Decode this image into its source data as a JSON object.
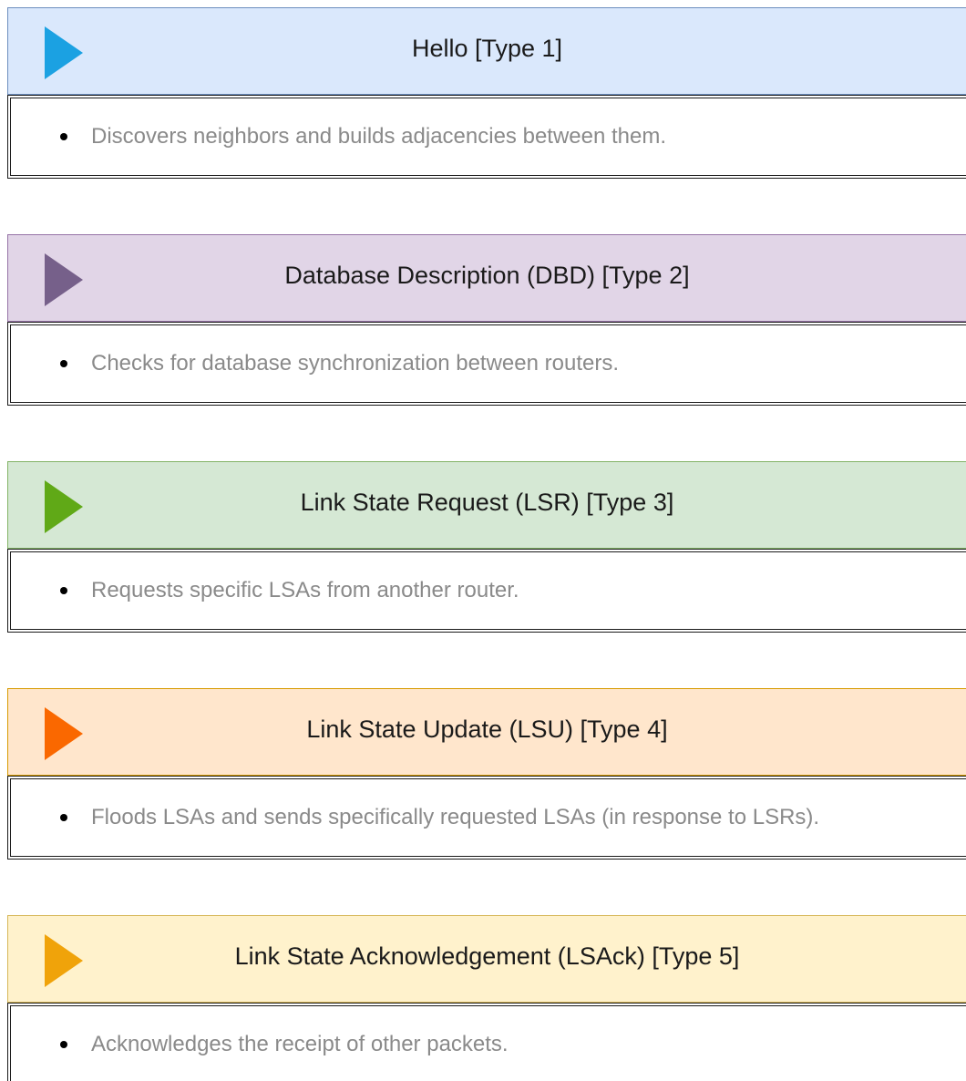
{
  "packets": [
    {
      "title": "Hello [Type 1]",
      "description": "Discovers neighbors and builds adjacencies between them.",
      "header_color": "#dae8fc",
      "border_color": "#6c8ebf",
      "arrow_color": "#1ba1e2",
      "arrow_icon": "play-triangle-icon"
    },
    {
      "title": "Database Description (DBD) [Type 2]",
      "description": "Checks for database synchronization between routers.",
      "header_color": "#e1d5e7",
      "border_color": "#9673a6",
      "arrow_color": "#76608a",
      "arrow_icon": "play-triangle-icon"
    },
    {
      "title": "Link State Request (LSR) [Type 3]",
      "description": "Requests specific LSAs from another router.",
      "header_color": "#d5e8d4",
      "border_color": "#82b366",
      "arrow_color": "#60a917",
      "arrow_icon": "play-triangle-icon"
    },
    {
      "title": "Link State Update (LSU) [Type 4]",
      "description": "Floods LSAs and sends specifically requested LSAs (in response to LSRs).",
      "header_color": "#ffe6cc",
      "border_color": "#d79b00",
      "arrow_color": "#fa6800",
      "arrow_icon": "play-triangle-icon"
    },
    {
      "title": "Link State Acknowledgement (LSAck) [Type 5]",
      "description": "Acknowledges the receipt of other packets.",
      "header_color": "#fff2cc",
      "border_color": "#d6b656",
      "arrow_color": "#f0a30a",
      "arrow_icon": "play-triangle-icon"
    }
  ]
}
